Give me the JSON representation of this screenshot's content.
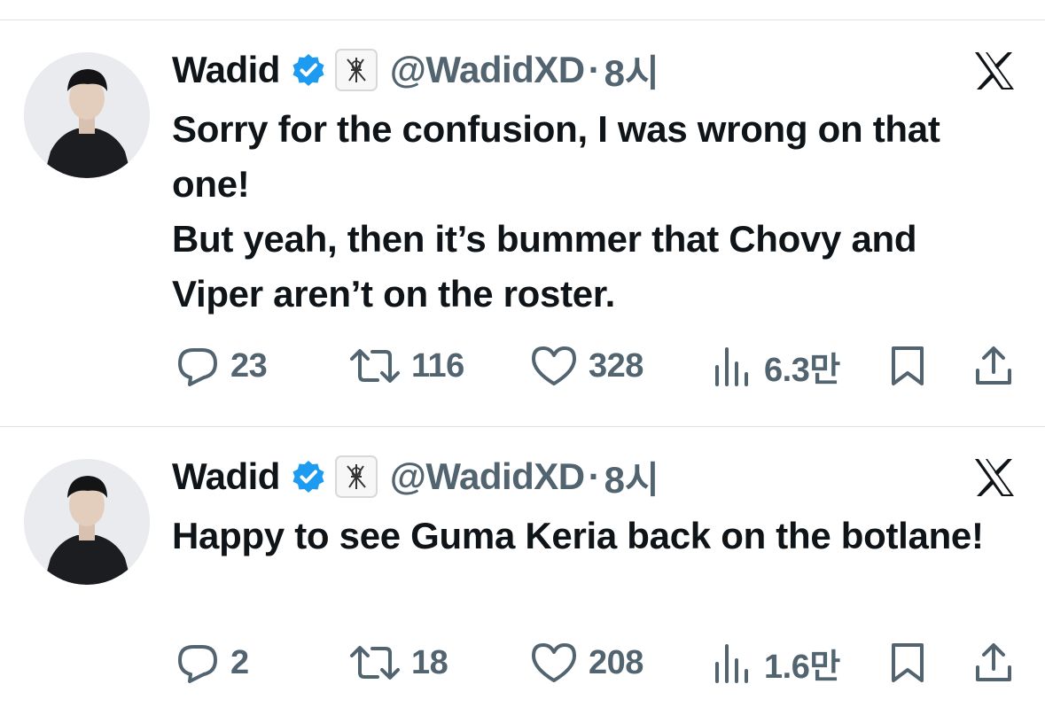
{
  "tweets": [
    {
      "author_name": "Wadid",
      "handle": "@WadidXD",
      "separator": "·",
      "time": "8시",
      "text_lines": [
        "Sorry for the confusion, I was wrong on that one!",
        "But yeah, then it’s bummer that Chovy and Viper aren’t on the roster."
      ],
      "replies": "23",
      "reposts": "116",
      "likes": "328",
      "views": "6.3만"
    },
    {
      "author_name": "Wadid",
      "handle": "@WadidXD",
      "separator": "·",
      "time": "8시",
      "text_lines": [
        "Happy to see Guma Keria back on the botlane!"
      ],
      "replies": "2",
      "reposts": "18",
      "likes": "208",
      "views": "1.6만"
    }
  ],
  "icons": {
    "verified": "verified-badge-icon",
    "affiliate": "affiliate-badge-icon",
    "platform": "x-logo-icon",
    "reply": "reply-icon",
    "repost": "repost-icon",
    "like": "heart-icon",
    "views": "views-icon",
    "bookmark": "bookmark-icon",
    "share": "share-icon"
  },
  "colors": {
    "text": "#0f1419",
    "secondary": "#536471",
    "verified": "#1d9bf0",
    "divider": "#dde1e4"
  }
}
